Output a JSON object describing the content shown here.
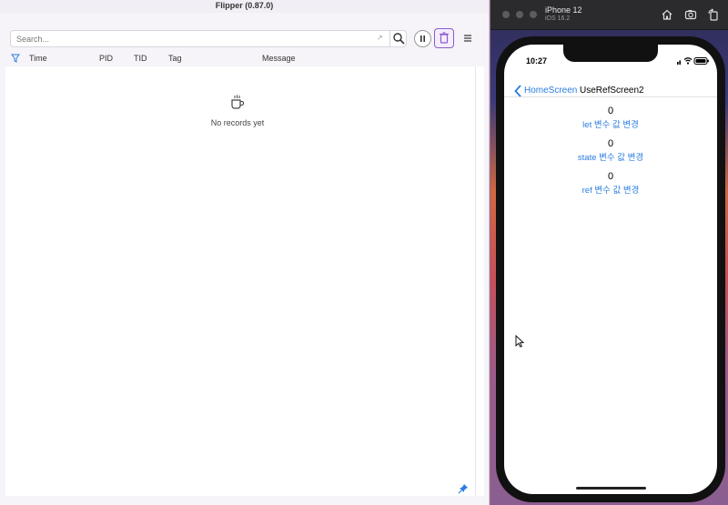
{
  "flipper": {
    "title": "Flipper (0.87.0)",
    "search": {
      "placeholder": "Search..."
    },
    "columns": [
      "Time",
      "PID",
      "TID",
      "Tag",
      "Message"
    ],
    "empty_message": "No records yet"
  },
  "simulator": {
    "device_name": "iPhone 12",
    "os_version": "iOS 16.2",
    "status_time": "10:27",
    "nav": {
      "back_label": "HomeScreen",
      "title": "UseRefScreen2"
    },
    "rows": [
      {
        "value": "0",
        "action": "let 변수 값 변경"
      },
      {
        "value": "0",
        "action": "state 변수 값 변경"
      },
      {
        "value": "0",
        "action": "ref 변수 값 변경"
      }
    ]
  },
  "colors": {
    "accent_blue": "#2a7de1",
    "delete_border": "#8a5ad0",
    "flipper_bg": "#f6f4f8"
  },
  "icons": [
    "filter-icon",
    "search-icon",
    "expand-icon",
    "pause-icon",
    "trash-icon",
    "menu-icon",
    "coffee-cup-icon",
    "pin-icon",
    "home-icon",
    "screenshot-icon",
    "rotate-icon",
    "chevron-left-icon",
    "signal-icon",
    "wifi-icon",
    "battery-icon"
  ]
}
